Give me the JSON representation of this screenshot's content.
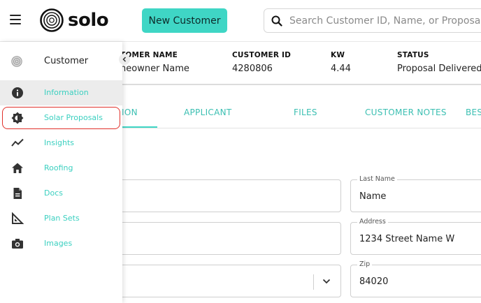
{
  "header": {
    "brand": "solo",
    "new_customer_label": "New Customer",
    "search_placeholder": "Search Customer ID, Name, or Proposal ID",
    "accent_color": "#3fd6c5"
  },
  "summary": {
    "customer_name_label": "TOMER NAME",
    "customer_name_value": "neowner Name",
    "customer_id_label": "CUSTOMER ID",
    "customer_id_value": "4280806",
    "kw_label": "KW",
    "kw_value": "4.44",
    "status_label": "STATUS",
    "status_value": "Proposal Delivered"
  },
  "tabs": [
    {
      "label": "ION"
    },
    {
      "label": "APPLICANT"
    },
    {
      "label": "FILES"
    },
    {
      "label": "CUSTOMER NOTES"
    },
    {
      "label": "BES"
    }
  ],
  "form": {
    "last_name_label": "Last Name",
    "last_name_value": "Name",
    "address_label": "Address",
    "address_value": "1234 Street Name W",
    "zip_label": "Zip",
    "zip_value": "84020"
  },
  "sidebar": {
    "title": "Customer",
    "items": [
      {
        "label": "Information",
        "icon": "info-icon"
      },
      {
        "label": "Solar Proposals",
        "icon": "solar-icon"
      },
      {
        "label": "Insights",
        "icon": "trend-icon"
      },
      {
        "label": "Roofing",
        "icon": "home-icon"
      },
      {
        "label": "Docs",
        "icon": "document-icon"
      },
      {
        "label": "Plan Sets",
        "icon": "ruler-icon"
      },
      {
        "label": "Images",
        "icon": "camera-icon"
      }
    ]
  }
}
